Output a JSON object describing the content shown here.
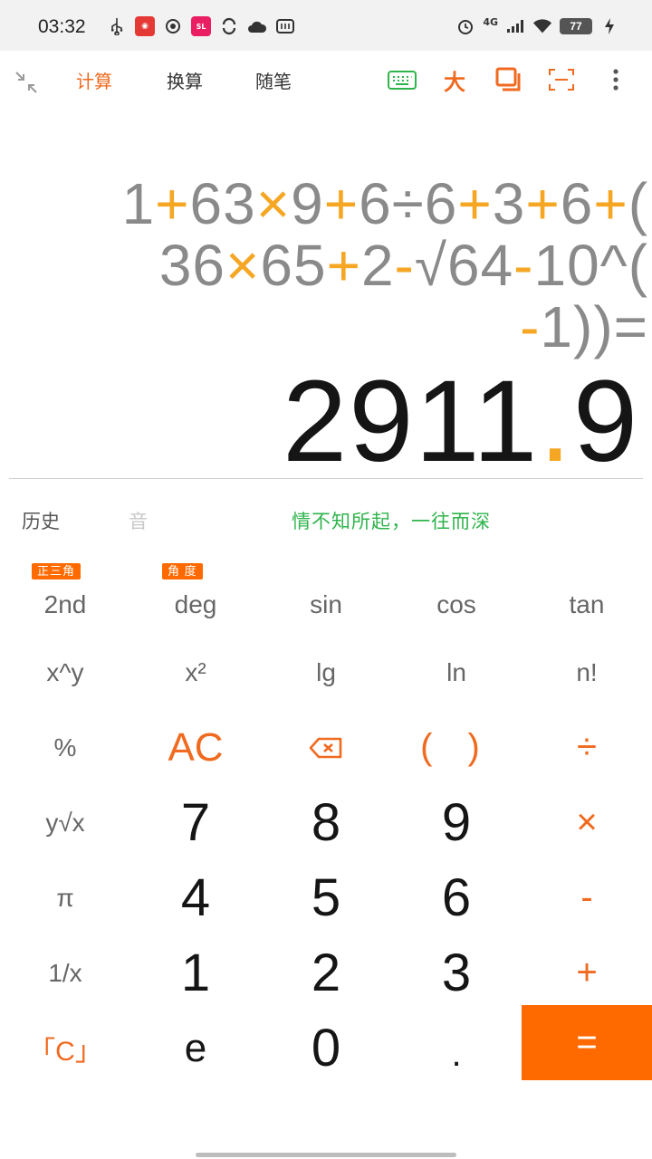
{
  "status_bar": {
    "time": "03:32",
    "left_icons": [
      "usb-icon",
      "app-badge-icon",
      "sync-icon",
      "app-pink-icon",
      "loop-icon",
      "cloud-icon",
      "weibo-icon"
    ],
    "network": "4G",
    "battery": "77"
  },
  "toolbar": {
    "tabs": [
      {
        "label": "计算",
        "active": true
      },
      {
        "label": "换算",
        "active": false
      },
      {
        "label": "随笔",
        "active": false
      }
    ],
    "big_text_label": "大",
    "accent_color": "#f06a1f"
  },
  "display": {
    "expression_lines": [
      [
        "1",
        "+",
        "63",
        "×",
        "9",
        "+",
        "6",
        "÷",
        "6",
        "+",
        "3",
        "+",
        "6",
        "+",
        "("
      ],
      [
        "36",
        "×",
        "65",
        "+",
        "2",
        "-",
        "√",
        "64",
        "-",
        "10^("
      ],
      [
        "-",
        "1))="
      ]
    ],
    "result_int": "2911",
    "result_dot": ".",
    "result_frac": "9"
  },
  "history_row": {
    "history_label": "历史",
    "sound_label": "音",
    "slogan": "情不知所起，一往而深"
  },
  "keypad": {
    "badges": {
      "second": "正三角",
      "deg": "角  度"
    },
    "rows": [
      [
        "2nd",
        "deg",
        "sin",
        "cos",
        "tan"
      ],
      [
        "x^y",
        "x²",
        "lg",
        "ln",
        "n!"
      ],
      [
        "%",
        "AC",
        "⌫",
        "( )",
        "÷"
      ],
      [
        "y√x",
        "7",
        "8",
        "9",
        "×"
      ],
      [
        "π",
        "4",
        "5",
        "6",
        "-"
      ],
      [
        "1/x",
        "1",
        "2",
        "3",
        "+"
      ],
      [
        "「C」",
        "e",
        "0",
        ".",
        "="
      ]
    ]
  }
}
